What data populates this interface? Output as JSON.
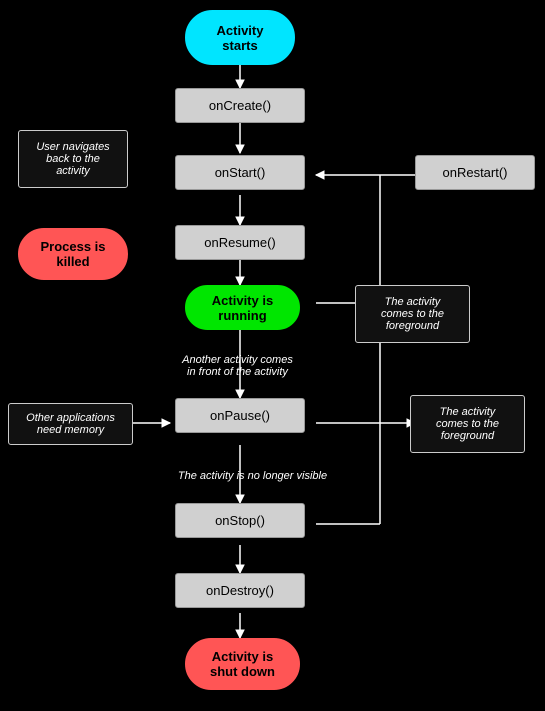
{
  "nodes": {
    "activity_starts": "Activity\nstarts",
    "onCreate": "onCreate()",
    "onStart": "onStart()",
    "onRestart": "onRestart()",
    "onResume": "onResume()",
    "activity_running": "Activity is\nrunning",
    "onPause": "onPause()",
    "onStop": "onStop()",
    "onDestroy": "onDestroy()",
    "activity_shutdown": "Activity is\nshut down"
  },
  "labels": {
    "user_navigates": "User navigates\nback to the\nactivity",
    "process_killed": "Process is\nkilled",
    "another_activity": "Another activity comes\nin front of the activity",
    "activity_foreground1": "The activity\ncomes to the\nforeground",
    "activity_foreground2": "The activity\ncomes to the\nforeground",
    "other_apps": "Other applications\nneed memory",
    "no_longer_visible": "The activity is no longer visible"
  }
}
